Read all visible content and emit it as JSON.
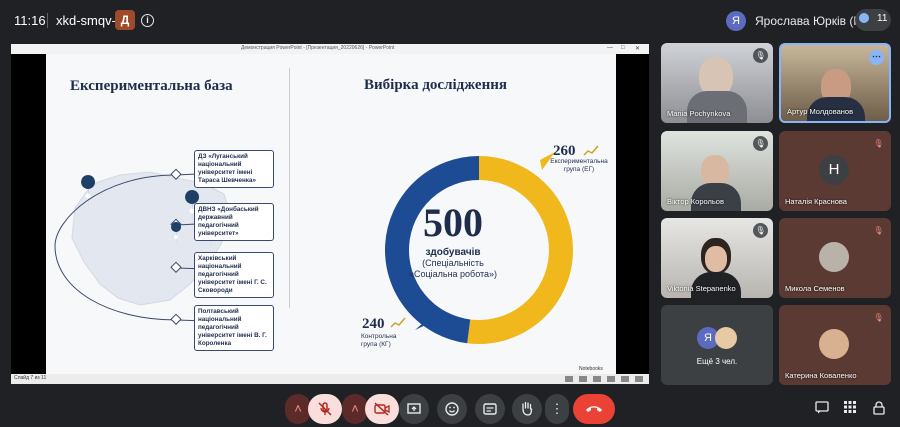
{
  "meeting": {
    "time": "11:16",
    "code": "xkd-smqv-fyd",
    "presentation_badge": "Д",
    "presenter_initial": "Я",
    "presenter_label": "Ярослава Юрків (Показ)",
    "participants_count": "11"
  },
  "window": {
    "title": "Демонстрация PowerPoint - [Презентация_20220626] - PowerPoint",
    "status": "Слайд 7 из 11",
    "logo_text": "Notebooks"
  },
  "slide": {
    "left_title": "Експериментальна база",
    "right_title": "Вибірка дослідження",
    "universities": [
      "ДЗ «Луганський національний університет імені Тараса Шевченка»",
      "ДВНЗ «Донбаський державний педагогічний університет»",
      "Харківський національний педагогічний університет імені Г. С. Сковороди",
      "Полтавський національний педагогічний університет імені В. Г. Короленка"
    ],
    "total": "500",
    "total_label": "здобувачів",
    "specialty_line1": "(Спеціальність",
    "specialty_line2": "«Соціальна робота»)",
    "eg_number": "260",
    "eg_label": "Експериментальна група (ЕГ)",
    "kg_number": "240",
    "kg_label_line1": "Контрольна",
    "kg_label_line2": "група (КГ)"
  },
  "chart_data": {
    "type": "pie",
    "categories": [
      "Експериментальна група (ЕГ)",
      "Контрольна група (КГ)"
    ],
    "values": [
      260,
      240
    ],
    "colors": [
      "#f0b81d",
      "#1e4c94"
    ]
  },
  "participants": [
    {
      "name": "Mariia Pochynkova",
      "muted": true
    },
    {
      "name": "Артур Молдованов",
      "muted": false,
      "active": true
    },
    {
      "name": "Віктор Корольов",
      "muted": true
    },
    {
      "name": "Наталія Краснова",
      "muted": true,
      "initial": "Н"
    },
    {
      "name": "Viktoriia Stepanenko",
      "muted": true
    },
    {
      "name": "Микола Семенов",
      "muted": true
    },
    {
      "name": "Ещё 3 чел.",
      "initial": "Я"
    },
    {
      "name": "Катерина Коваленко",
      "muted": true
    }
  ],
  "icons": {
    "mic": "microphone-off-icon",
    "camera": "camera-off-icon",
    "present": "present-icon",
    "emoji": "emoji-icon",
    "captions": "captions-icon",
    "hand": "raise-hand-icon",
    "more": "more-options-icon",
    "end": "end-call-icon"
  }
}
